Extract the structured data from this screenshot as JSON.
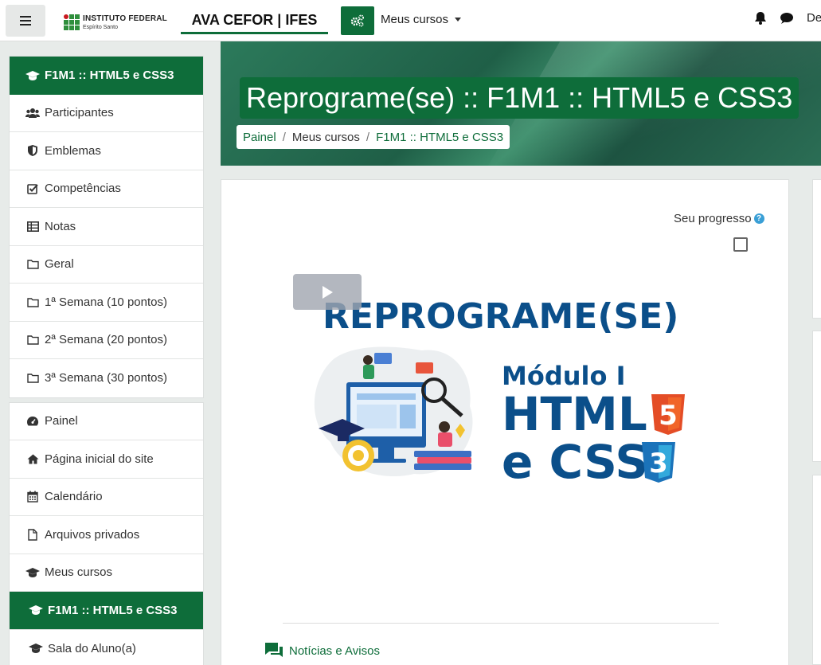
{
  "navbar": {
    "logo_main": "INSTITUTO FEDERAL",
    "logo_sub": "Espírito Santo",
    "site_title": "AVA CEFOR | IFES",
    "my_courses_label": "Meus cursos",
    "user_truncated": "De"
  },
  "sidebar": {
    "group1": [
      {
        "label": "F1M1 :: HTML5 e CSS3",
        "icon": "graduation-cap-icon"
      },
      {
        "label": "Participantes",
        "icon": "users-icon"
      },
      {
        "label": "Emblemas",
        "icon": "shield-icon"
      },
      {
        "label": "Competências",
        "icon": "check-square-icon"
      },
      {
        "label": "Notas",
        "icon": "table-icon"
      },
      {
        "label": "Geral",
        "icon": "folder-icon"
      },
      {
        "label": "1ª Semana (10 pontos)",
        "icon": "folder-icon"
      },
      {
        "label": "2ª Semana (20 pontos)",
        "icon": "folder-icon"
      },
      {
        "label": "3ª Semana (30 pontos)",
        "icon": "folder-icon"
      }
    ],
    "group2": [
      {
        "label": "Painel",
        "icon": "dashboard-icon"
      },
      {
        "label": "Página inicial do site",
        "icon": "home-icon"
      },
      {
        "label": "Calendário",
        "icon": "calendar-icon"
      },
      {
        "label": "Arquivos privados",
        "icon": "file-icon"
      },
      {
        "label": "Meus cursos",
        "icon": "graduation-cap-icon"
      },
      {
        "label": "F1M1 :: HTML5 e CSS3",
        "icon": "graduation-cap-icon"
      },
      {
        "label": "Sala do Aluno(a)",
        "icon": "graduation-cap-icon"
      }
    ]
  },
  "header": {
    "course_title": "Reprograme(se) :: F1M1 :: HTML5 e CSS3",
    "breadcrumb": [
      "Painel",
      "Meus cursos",
      "F1M1 :: HTML5 e CSS3"
    ]
  },
  "main": {
    "progress_label": "Seu progresso",
    "help_glyph": "?",
    "image": {
      "headline": "REPROGRAME(SE)",
      "module": "Módulo I",
      "line1": "HTML",
      "line2": "e CSS",
      "badge5": "5",
      "badge3": "3"
    },
    "news_link": "Notícias e Avisos"
  },
  "colors": {
    "brand_green": "#0e6d3a",
    "image_blue": "#0b4f8a",
    "html5_orange": "#e44d26",
    "css3_blue": "#1b73ba"
  }
}
